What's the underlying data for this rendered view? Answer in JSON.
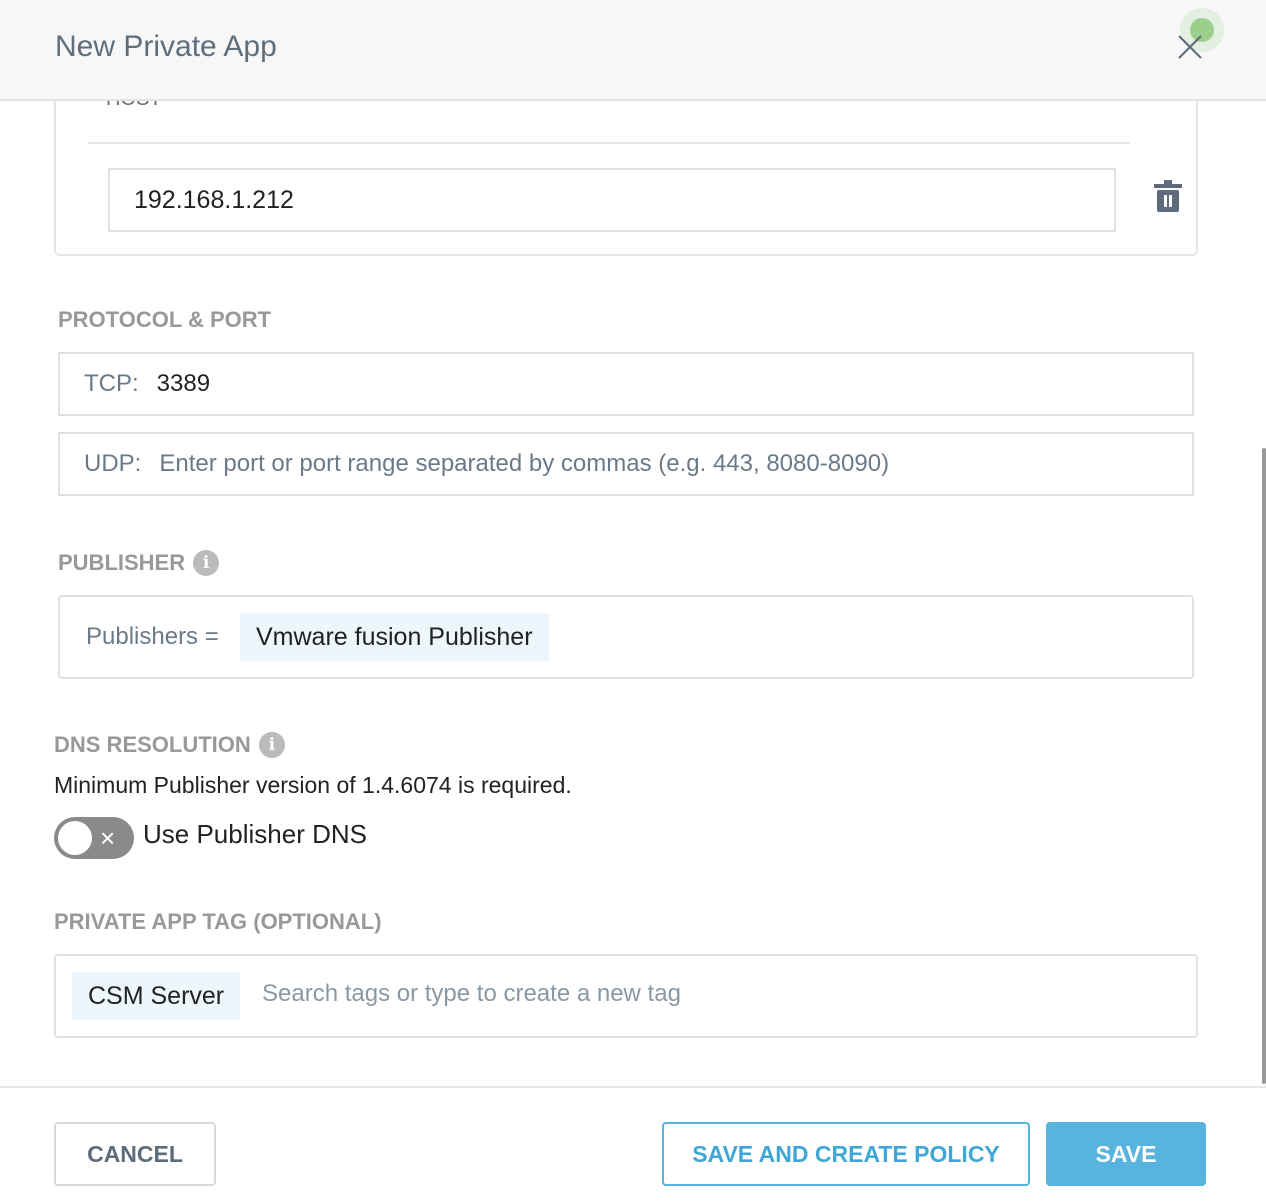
{
  "header": {
    "title": "New Private App",
    "close_icon": "close-icon"
  },
  "host": {
    "label": "HOST",
    "value": "192.168.1.212",
    "delete_icon": "trash-icon"
  },
  "protocol": {
    "label": "PROTOCOL & PORT",
    "tcp_prefix": "TCP:",
    "tcp_value": "3389",
    "udp_prefix": "UDP:",
    "udp_placeholder": "Enter port or port range separated by commas (e.g. 443, 8080-8090)"
  },
  "publisher": {
    "label": "PUBLISHER",
    "prefix": "Publishers =",
    "chip": "Vmware fusion Publisher"
  },
  "dns": {
    "label": "DNS RESOLUTION",
    "note": "Minimum Publisher version of 1.4.6074 is required.",
    "toggle_label": "Use Publisher DNS",
    "toggle_on": false
  },
  "tags": {
    "label": "PRIVATE APP TAG (OPTIONAL)",
    "chip": "CSM Server",
    "placeholder": "Search tags or type to create a new tag"
  },
  "footer": {
    "cancel": "CANCEL",
    "save_create": "SAVE AND CREATE POLICY",
    "save": "SAVE"
  },
  "colors": {
    "accent": "#58b4de",
    "status_dot": "#9ccf8a"
  }
}
